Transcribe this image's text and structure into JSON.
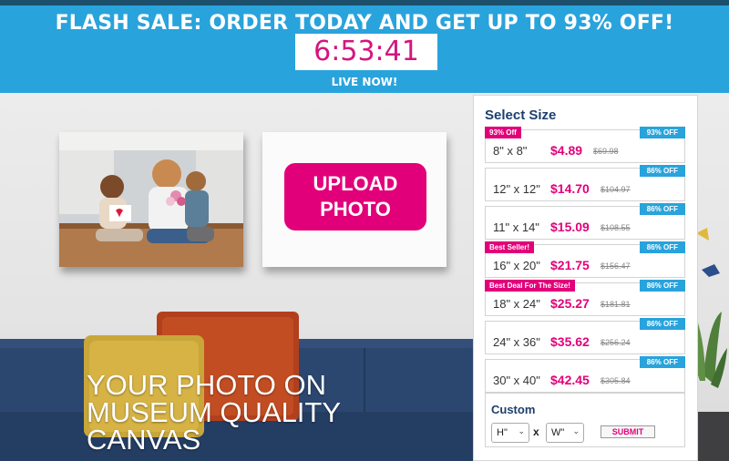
{
  "banner": {
    "title": "FLASH SALE: ORDER TODAY AND GET UP TO 93% OFF!",
    "timer": "6:53:41",
    "live": "LIVE NOW!"
  },
  "upload": {
    "label_line1": "UPLOAD",
    "label_line2": "PHOTO"
  },
  "headline": {
    "line1": "YOUR PHOTO ON",
    "line2": "MUSEUM QUALITY",
    "line3": "CANVAS"
  },
  "panel": {
    "title": "Select Size",
    "sizes": [
      {
        "size": "8\" x 8\"",
        "price": "$4.89",
        "old_price": "$69.98",
        "discount": "93% OFF",
        "tag": "93% Off"
      },
      {
        "size": "12\" x 12\"",
        "price": "$14.70",
        "old_price": "$104.97",
        "discount": "86% OFF",
        "tag": ""
      },
      {
        "size": "11\" x 14\"",
        "price": "$15.09",
        "old_price": "$108.55",
        "discount": "86% OFF",
        "tag": ""
      },
      {
        "size": "16\" x 20\"",
        "price": "$21.75",
        "old_price": "$156.47",
        "discount": "86% OFF",
        "tag": "Best Seller!"
      },
      {
        "size": "18\" x 24\"",
        "price": "$25.27",
        "old_price": "$181.81",
        "discount": "86% OFF",
        "tag": "Best Deal For The Size!"
      },
      {
        "size": "24\" x 36\"",
        "price": "$35.62",
        "old_price": "$256.24",
        "discount": "86% OFF",
        "tag": ""
      },
      {
        "size": "30\" x 40\"",
        "price": "$42.45",
        "old_price": "$305.84",
        "discount": "86% OFF",
        "tag": ""
      }
    ],
    "custom": {
      "title": "Custom",
      "height_value": "H\"",
      "width_value": "W\"",
      "x_label": "x",
      "submit_label": "SUBMIT"
    }
  },
  "colors": {
    "brand_blue": "#29a3dc",
    "brand_pink": "#e2007a",
    "navy": "#1c3f6e"
  }
}
